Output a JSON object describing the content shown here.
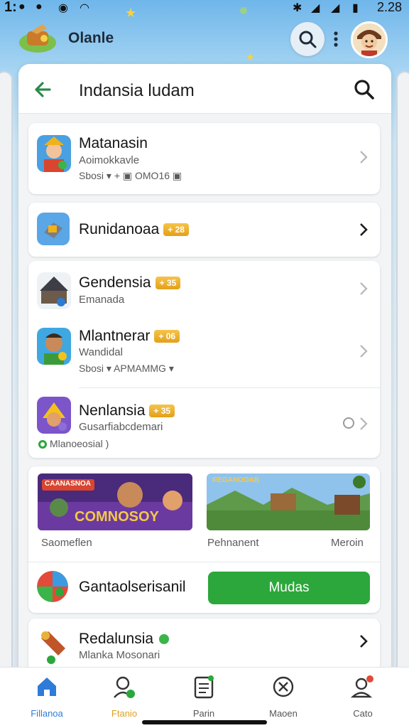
{
  "status_bar": {
    "time_left": "1:",
    "time_right": "2.28"
  },
  "header": {
    "app_title": "Olanle"
  },
  "panel": {
    "title": "Indansia ludam",
    "rows": [
      {
        "title": "Matanasin",
        "sub": "Aoimokkavle",
        "meta": "Sbosi ▾ + ▣ OMO16 ▣"
      },
      {
        "title": "Runidanoaa",
        "badge": "+ 28"
      },
      {
        "title": "Gendensia",
        "badge": "+ 35",
        "sub": "Emanada"
      },
      {
        "title": "Mlantnerar",
        "badge": "+ 06",
        "sub": "Wandidal",
        "meta": "Sbosi ▾ APMAMMG ▾"
      },
      {
        "title": "Nenlansia",
        "badge": "+ 35",
        "sub": "Gusarfiabcdemari",
        "meta": "Mlanoeosial )"
      }
    ],
    "promo": {
      "banner_left_text": "COMNOSOY",
      "banner_left_tag": "CAANASNOA",
      "banner_right_tag": "REGANOOAB",
      "label_left": "Saomeflen",
      "label_mid": "Pehnanent",
      "label_right": "Meroin",
      "feature_title": "Gantaolserisanil",
      "cta_label": "Mudas"
    },
    "last_row": {
      "title": "Redalunsia",
      "sub": "Mlanka Mosonari"
    }
  },
  "bottom_nav": [
    {
      "label": "Fillanoa",
      "icon": "home-icon",
      "active": true
    },
    {
      "label": "Ftanio",
      "icon": "profile-check-icon"
    },
    {
      "label": "Parin",
      "icon": "clipboard-icon"
    },
    {
      "label": "Maoen",
      "icon": "cross-circle-icon"
    },
    {
      "label": "Cato",
      "icon": "user-notify-icon"
    }
  ],
  "colors": {
    "accent_green": "#2ca73b",
    "badge_gold": "#e4a019",
    "nav_active": "#2f7bd8"
  }
}
